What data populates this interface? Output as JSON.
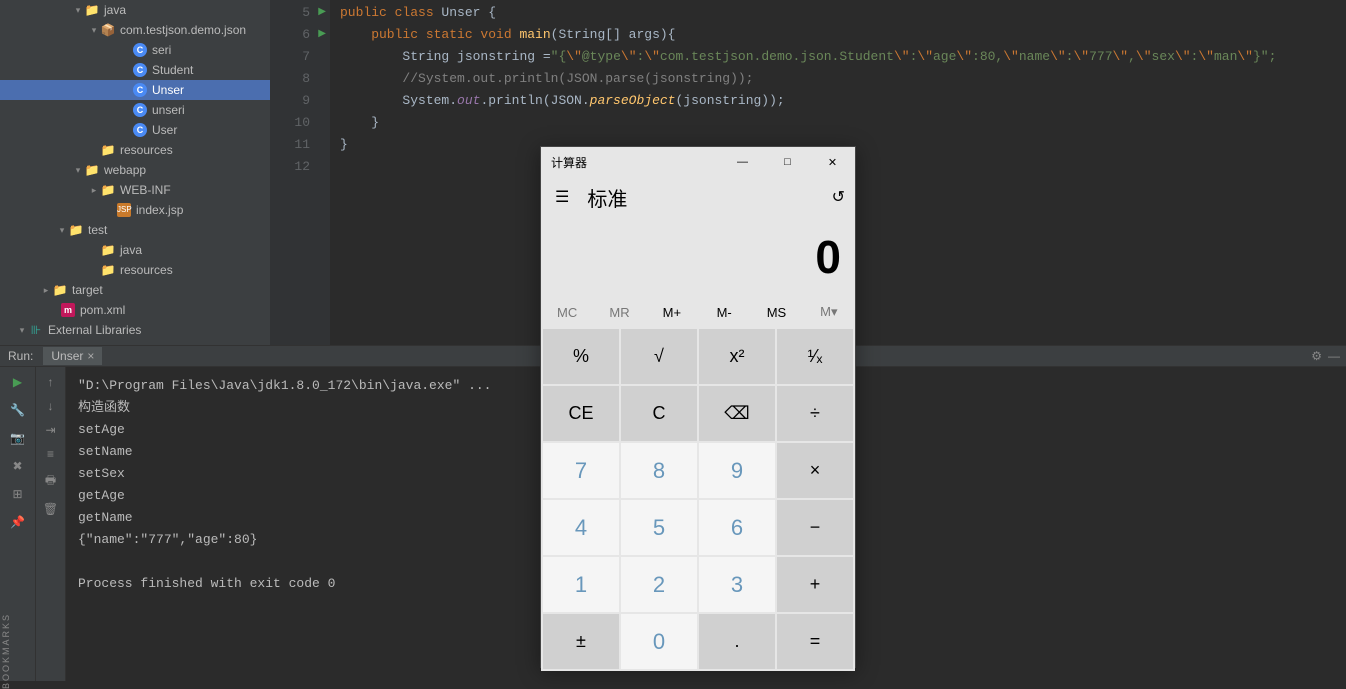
{
  "tree": {
    "items": [
      {
        "indent": 72,
        "arrow": "▾",
        "icon": "folder-blue",
        "label": "java"
      },
      {
        "indent": 88,
        "arrow": "▾",
        "icon": "pkg",
        "label": "com.testjson.demo.json"
      },
      {
        "indent": 120,
        "arrow": "",
        "icon": "class",
        "label": "seri"
      },
      {
        "indent": 120,
        "arrow": "",
        "icon": "class",
        "label": "Student"
      },
      {
        "indent": 120,
        "arrow": "",
        "icon": "class",
        "label": "Unser",
        "selected": true
      },
      {
        "indent": 120,
        "arrow": "",
        "icon": "class",
        "label": "unseri"
      },
      {
        "indent": 120,
        "arrow": "",
        "icon": "class",
        "label": "User"
      },
      {
        "indent": 88,
        "arrow": "",
        "icon": "folder",
        "label": "resources"
      },
      {
        "indent": 72,
        "arrow": "▾",
        "icon": "folder-blue",
        "label": "webapp"
      },
      {
        "indent": 88,
        "arrow": "▸",
        "icon": "folder",
        "label": "WEB-INF"
      },
      {
        "indent": 104,
        "arrow": "",
        "icon": "jsp",
        "label": "index.jsp"
      },
      {
        "indent": 56,
        "arrow": "▾",
        "icon": "folder",
        "label": "test"
      },
      {
        "indent": 88,
        "arrow": "",
        "icon": "folder",
        "label": "java"
      },
      {
        "indent": 88,
        "arrow": "",
        "icon": "folder",
        "label": "resources"
      },
      {
        "indent": 40,
        "arrow": "▸",
        "icon": "folder-orange",
        "label": "target"
      },
      {
        "indent": 48,
        "arrow": "",
        "icon": "m",
        "label": "pom.xml"
      },
      {
        "indent": 16,
        "arrow": "▾",
        "icon": "lib",
        "label": "External Libraries"
      }
    ]
  },
  "editor": {
    "lines": [
      5,
      6,
      7,
      8,
      9,
      10,
      11,
      12
    ],
    "play_on": [
      5,
      6
    ],
    "code": {
      "l5": {
        "kw1": "public class",
        "cls": " Unser",
        "brace": " {"
      },
      "l6": {
        "kw": "    public static void ",
        "mth": "main",
        "rest": "(String[] args){"
      },
      "l7": {
        "pre": "        String ",
        "var": "jsonstring",
        "eq": " =",
        "q1": "\"",
        "s1": "{",
        "esc1": "\\\"",
        "s2": "@type",
        "esc2": "\\\"",
        "s3": ":",
        "esc3": "\\\"",
        "s4": "com.testjson.demo.json.Student",
        "esc4": "\\\"",
        "s5": ":",
        "esc5": "\\\"",
        "s6": "age",
        "esc6": "\\\"",
        "s7": ":80,",
        "esc7": "\\\"",
        "s8": "name",
        "esc8": "\\\"",
        "s9": ":",
        "esc9": "\\\"",
        "s10": "777",
        "esc10": "\\\"",
        "s11": ",",
        "esc11": "\\\"",
        "s12": "sex",
        "esc12": "\\\"",
        "s13": ":",
        "esc13": "\\\"",
        "s14": "man",
        "esc14": "\\\"",
        "s15": "}",
        "q2": "\";"
      },
      "l8": {
        "cmt": "        //System.out.println(JSON.parse(jsonstring));"
      },
      "l9": {
        "pre": "        System.",
        "out": "out",
        ".p": ".println(JSON.",
        "po": "parseObject",
        "rest": "(jsonstring));"
      },
      "l10": "    }",
      "l11": "}",
      "l12": ""
    }
  },
  "run": {
    "label": "Run:",
    "tab": "Unser",
    "lines": [
      "\"D:\\Program Files\\Java\\jdk1.8.0_172\\bin\\java.exe\" ...",
      "构造函数",
      "setAge",
      "setName",
      "setSex",
      "getAge",
      "getName",
      "{\"name\":\"777\",\"age\":80}",
      "",
      "Process finished with exit code 0"
    ]
  },
  "calc": {
    "title": "计算器",
    "mode": "标准",
    "display": "0",
    "mem": [
      "MC",
      "MR",
      "M+",
      "M-",
      "MS",
      "M▾"
    ],
    "buttons": [
      {
        "t": "%",
        "c": "dark"
      },
      {
        "t": "√",
        "c": "dark"
      },
      {
        "t": "x²",
        "c": "dark"
      },
      {
        "t": "¹⁄ₓ",
        "c": "dark"
      },
      {
        "t": "CE",
        "c": "dark"
      },
      {
        "t": "C",
        "c": "dark"
      },
      {
        "t": "⌫",
        "c": "dark"
      },
      {
        "t": "÷",
        "c": "dark"
      },
      {
        "t": "7",
        "c": "num"
      },
      {
        "t": "8",
        "c": "num"
      },
      {
        "t": "9",
        "c": "num"
      },
      {
        "t": "×",
        "c": "dark"
      },
      {
        "t": "4",
        "c": "num"
      },
      {
        "t": "5",
        "c": "num"
      },
      {
        "t": "6",
        "c": "num"
      },
      {
        "t": "−",
        "c": "dark"
      },
      {
        "t": "1",
        "c": "num"
      },
      {
        "t": "2",
        "c": "num"
      },
      {
        "t": "3",
        "c": "num"
      },
      {
        "t": "+",
        "c": "dark"
      },
      {
        "t": "±",
        "c": "dark"
      },
      {
        "t": "0",
        "c": "num"
      },
      {
        "t": ".",
        "c": "dark"
      },
      {
        "t": "=",
        "c": "dark"
      }
    ]
  },
  "bookmarks": "BOOKMARKS"
}
